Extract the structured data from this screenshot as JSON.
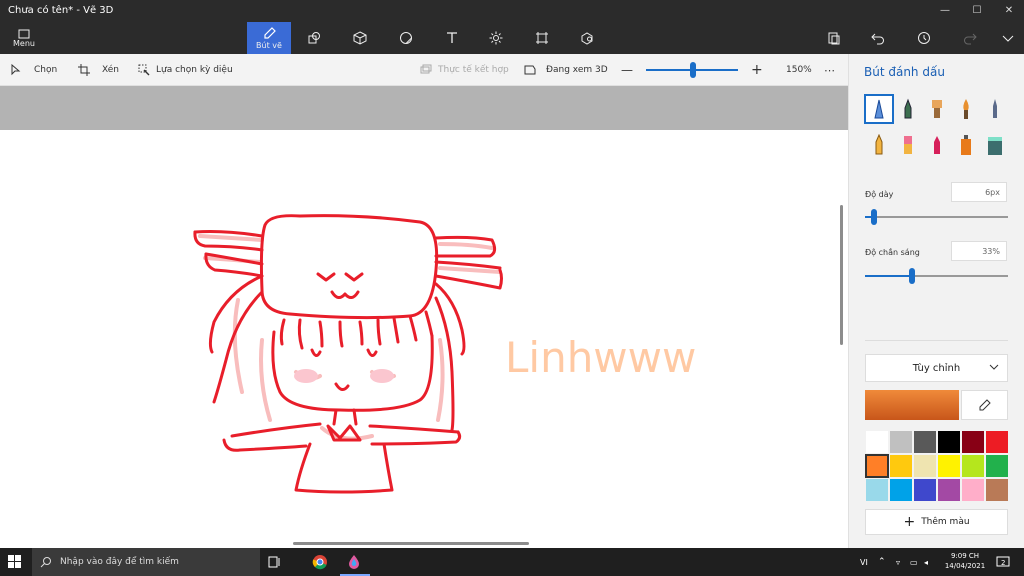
{
  "window": {
    "title": "Chưa có tên* - Vẽ 3D"
  },
  "toolbar": {
    "menu_label": "Menu",
    "tools": [
      {
        "name": "brushes",
        "label": "Bút vẽ",
        "active": true,
        "icon": "brush-icon"
      },
      {
        "name": "2d-shapes",
        "label": "",
        "icon": "shapes-2d-icon"
      },
      {
        "name": "3d-shapes",
        "label": "",
        "icon": "cube-icon"
      },
      {
        "name": "stickers",
        "label": "",
        "icon": "sticker-icon"
      },
      {
        "name": "text",
        "label": "",
        "icon": "text-icon"
      },
      {
        "name": "effects",
        "label": "",
        "icon": "effects-icon"
      },
      {
        "name": "canvas",
        "label": "",
        "icon": "canvas-icon"
      },
      {
        "name": "3d-library",
        "label": "",
        "icon": "library-icon"
      }
    ]
  },
  "subbar": {
    "select": "Chọn",
    "crop": "Xén",
    "magic_select": "Lựa chọn kỳ diệu",
    "mixed_reality": "Thực tế kết hợp",
    "view_3d": "Đang xem 3D",
    "zoom": "150%",
    "more": "⋯"
  },
  "canvas": {
    "signature": "Linhwww"
  },
  "panel": {
    "title": "Bút đánh dấu",
    "thickness_label": "Độ dày",
    "thickness_value": "6px",
    "thickness_fraction": 0.06,
    "opacity_label": "Độ chắn sáng",
    "opacity_value": "33%",
    "opacity_fraction": 0.33,
    "color_mode": "Tùy chỉnh",
    "add_color": "Thêm màu",
    "current_color": "#e0722a",
    "swatches": [
      "#ffffff",
      "#c0c0c0",
      "#595959",
      "#000000",
      "#880015",
      "#ed1c24",
      "#ff7f27",
      "#ffc90e",
      "#efe4b0",
      "#fff200",
      "#b5e61d",
      "#22b14c",
      "#99d9ea",
      "#00a2e8",
      "#3f48cc",
      "#a349a4",
      "#ffaec9",
      "#b97a57"
    ],
    "brushes": [
      "marker",
      "calligraphy-pen",
      "oil-brush",
      "watercolor",
      "pixel-pen",
      "pencil",
      "eraser",
      "crayon",
      "spray-can",
      "fill"
    ]
  },
  "taskbar": {
    "search_placeholder": "Nhập vào đây để tìm kiếm",
    "lang": "VI",
    "time": "9:09 CH",
    "date": "14/04/2021",
    "notifications": "2"
  }
}
